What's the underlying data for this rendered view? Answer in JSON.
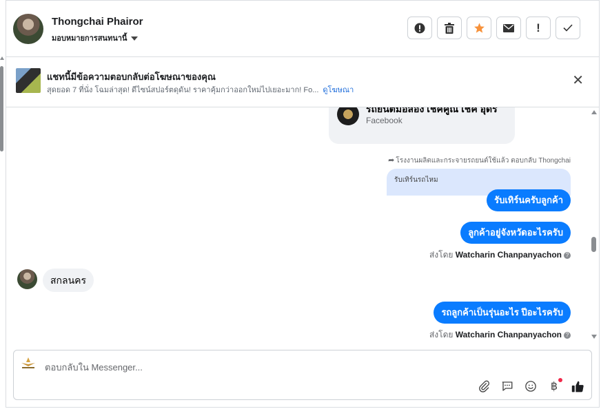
{
  "header": {
    "name": "Thongchai Phairor",
    "assign_label": "มอบหมายการสนทนานี้"
  },
  "actions": [
    {
      "name": "alert-circle-icon"
    },
    {
      "name": "trash-icon"
    },
    {
      "name": "star-icon",
      "color": "#f7923b"
    },
    {
      "name": "envelope-icon"
    },
    {
      "name": "exclamation-icon"
    },
    {
      "name": "check-icon"
    }
  ],
  "ad": {
    "title": "แชทนี้มีข้อความตอบกลับต่อโฆษณาของคุณ",
    "description": "สุดยอด 7 ที่นั่ง โฉมล่าสุด! ดีไซน์สปอร์ตดุดัน! ราคาคุ้มกว่าออกใหม่ไปเยอะมาก! Fo...",
    "link": "ดูโฆษณา"
  },
  "conversation": {
    "page_card": {
      "title": "รถยนต์มือสอง เชคคูณ เชค อุดร",
      "subtitle": "Facebook"
    },
    "reply_note": "โรงงานผลิตและกระจายรถยนต์ใช้แล้ว ตอบกลับ Thongchai",
    "quoted_text": "รับเทิร์นรถไหม",
    "outgoing_1": "รับเทิร์นครับลูกค้า",
    "outgoing_2": "ลูกค้าอยู่จังหวัดอะไรครับ",
    "sent_by_prefix": "ส่งโดย",
    "sent_by_name": "Watcharin Chanpanyachon",
    "incoming_1": "สกลนคร",
    "outgoing_3": "รถลูกค้าเป็นรุ่นอะไร ปีอะไรครับ"
  },
  "composer": {
    "placeholder": "ตอบกลับใน Messenger...",
    "tools": [
      "paperclip-icon",
      "chat-bubble-icon",
      "smiley-icon",
      "baht-icon",
      "thumbs-up-icon"
    ],
    "accent": "#0a7cff"
  }
}
